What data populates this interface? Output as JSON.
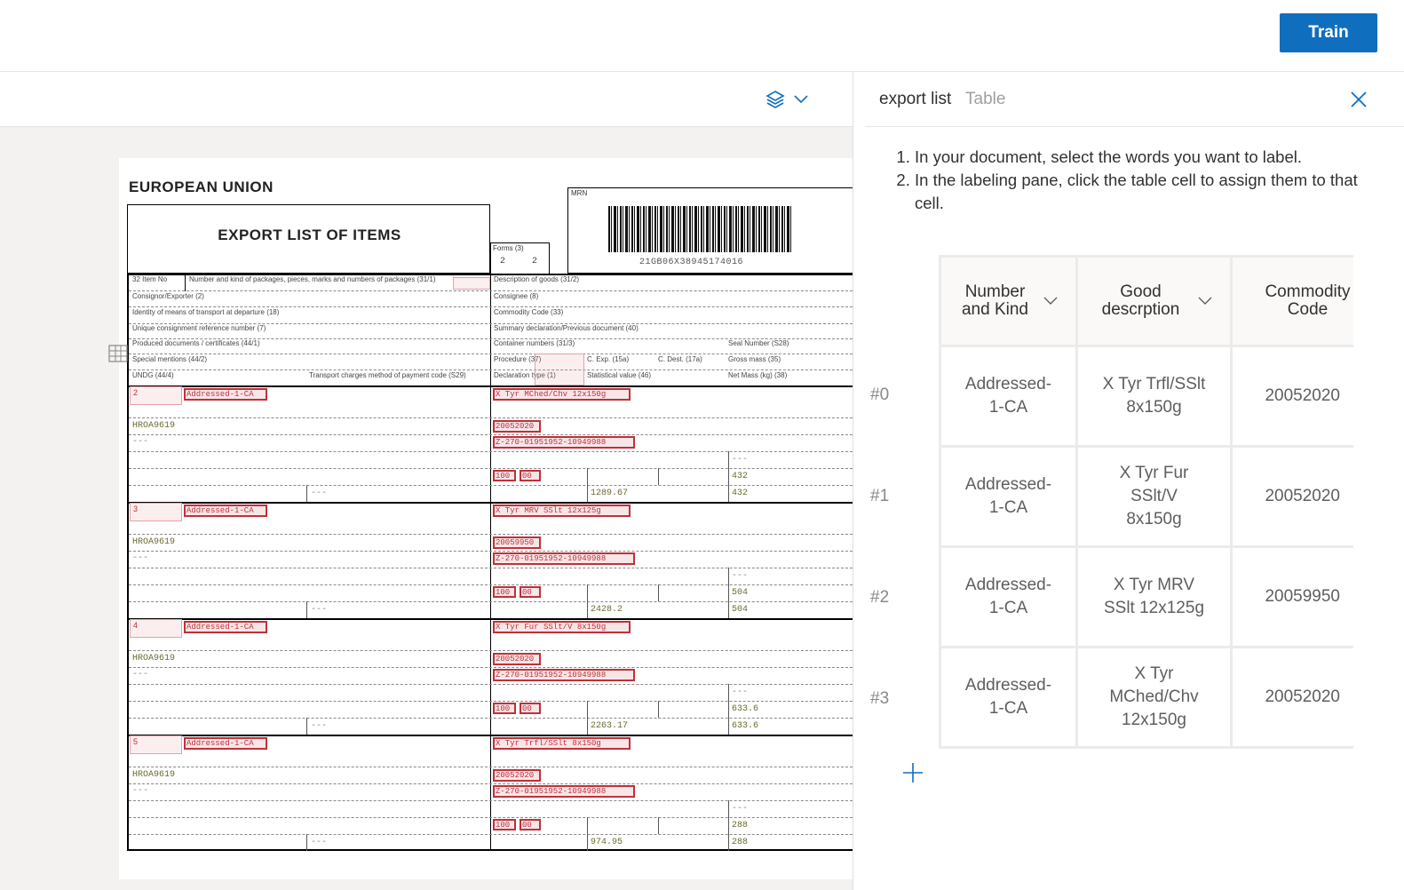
{
  "topbar": {
    "train_label": "Train"
  },
  "document": {
    "header": "EUROPEAN UNION",
    "title": "EXPORT LIST OF ITEMS",
    "forms_label": "Forms (3)",
    "forms_values": "2 2",
    "mrn_label": "MRN",
    "mrn_value": "21GB06X38945174016",
    "fields": {
      "item_no": "32 Item No",
      "packages": "Number and kind of packages, pieces, marks and numbers of packages (31/1)",
      "description": "Description of goods (31/2)",
      "consignor": "Consignor/Exporter (2)",
      "consignee": "Consignee (8)",
      "transport_id": "Identity of means of transport at departure (18)",
      "commodity_code": "Commodity Code (33)",
      "ucr": "Unique consignment reference number (7)",
      "summary_decl": "Summary declaration/Previous document (40)",
      "produced_docs": "Produced documents / certificates (44/1)",
      "container": "Container numbers (31/3)",
      "seal": "Seal Number (S28)",
      "special": "Special mentions (44/2)",
      "procedure": "Procedure (37)",
      "c_exp": "C. Exp. (15a)",
      "c_dest": "C. Dest. (17a)",
      "gross": "Gross mass (35)",
      "undg": "UNDG (44/4)",
      "transport_charges": "Transport charges method of payment code (S29)",
      "decl_type": "Declaration type (1)",
      "stat_value": "Statistical value (46)",
      "net_mass": "Net Mass (kg) (38)"
    },
    "items": [
      {
        "num": "2",
        "addr": "Addressed-1-CA",
        "desc": "X Tyr MChed/Chv 12x150g",
        "code": "HROA9619",
        "comm": "20052020",
        "ref": "Z-270-01951952-10949988",
        "dash": "---",
        "c1": "100",
        "c2": "00",
        "val": "1289.67",
        "gross": "432",
        "net": "432"
      },
      {
        "num": "3",
        "addr": "Addressed-1-CA",
        "desc": "X Tyr MRV SSlt 12x125g",
        "code": "HROA9619",
        "comm": "20059950",
        "ref": "Z-270-01951952-10949988",
        "dash": "---",
        "c1": "100",
        "c2": "00",
        "val": "2428.2",
        "gross": "504",
        "net": "504"
      },
      {
        "num": "4",
        "addr": "Addressed-1-CA",
        "desc": "X Tyr Fur SSlt/V 8x150g",
        "code": "HROA9619",
        "comm": "20052020",
        "ref": "Z-270-01951952-10949988",
        "dash": "---",
        "c1": "100",
        "c2": "00",
        "val": "2263.17",
        "gross": "633.6",
        "net": "633.6"
      },
      {
        "num": "5",
        "addr": "Addressed-1-CA",
        "desc": "X Tyr Trfl/SSlt 8x150g",
        "code": "HROA9619",
        "comm": "20052020",
        "ref": "Z-270-01951952-10949988",
        "dash": "---",
        "c1": "100",
        "c2": "00",
        "val": "974.95",
        "gross": "288",
        "net": "288"
      }
    ]
  },
  "label_pane": {
    "title": "export list",
    "type": "Table",
    "instructions": [
      "In your document, select the words you want to label.",
      "In the labeling pane, click the table cell to assign them to that cell."
    ],
    "columns": [
      "Number and Kind",
      "Good descrption",
      "Commodity Code"
    ],
    "rows": [
      {
        "label": "#0",
        "cells": [
          "Addressed-1-CA",
          "X Tyr Trfl/SSlt 8x150g",
          "20052020"
        ]
      },
      {
        "label": "#1",
        "cells": [
          "Addressed-1-CA",
          "X Tyr Fur SSlt/V 8x150g",
          "20052020"
        ]
      },
      {
        "label": "#2",
        "cells": [
          "Addressed-1-CA",
          "X Tyr MRV SSlt 12x125g",
          "20059950"
        ]
      },
      {
        "label": "#3",
        "cells": [
          "Addressed-1-CA",
          "X Tyr MChed/Chv 12x150g",
          "20052020"
        ]
      }
    ]
  },
  "icons": [
    "layers-icon",
    "chevron-down-icon",
    "close-icon",
    "add-icon",
    "table-icon"
  ],
  "colors": {
    "accent": "#106ebe",
    "highlight": "#c0303a"
  }
}
